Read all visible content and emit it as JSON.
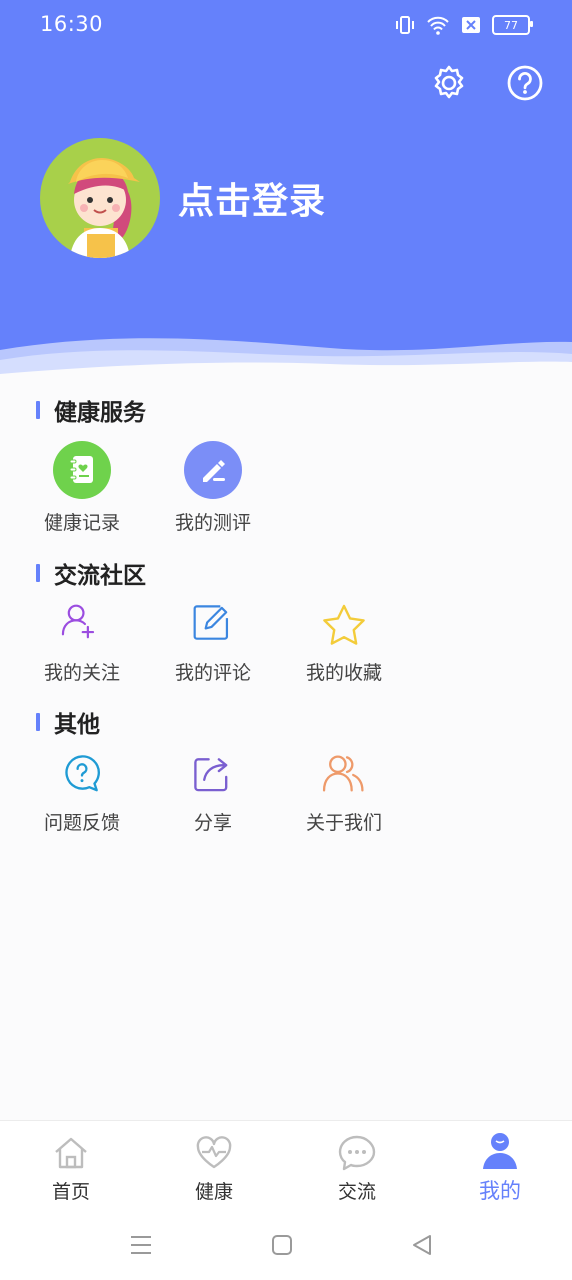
{
  "status": {
    "time": "16:30",
    "battery": "77"
  },
  "profile": {
    "login_label": "点击登录"
  },
  "sections": [
    {
      "title": "健康服务",
      "items": [
        {
          "label": "健康记录",
          "icon": "health-record-icon"
        },
        {
          "label": "我的测评",
          "icon": "assessment-icon"
        }
      ]
    },
    {
      "title": "交流社区",
      "items": [
        {
          "label": "我的关注",
          "icon": "follow-user-icon"
        },
        {
          "label": "我的评论",
          "icon": "edit-comment-icon"
        },
        {
          "label": "我的收藏",
          "icon": "star-icon"
        }
      ]
    },
    {
      "title": "其他",
      "items": [
        {
          "label": "问题反馈",
          "icon": "question-bubble-icon"
        },
        {
          "label": "分享",
          "icon": "share-icon"
        },
        {
          "label": "关于我们",
          "icon": "people-icon"
        }
      ]
    }
  ],
  "tabs": [
    {
      "label": "首页",
      "icon": "home-icon"
    },
    {
      "label": "健康",
      "icon": "heart-pulse-icon"
    },
    {
      "label": "交流",
      "icon": "chat-bubble-icon"
    },
    {
      "label": "我的",
      "icon": "user-icon",
      "active": true
    }
  ],
  "colors": {
    "primary": "#6581fb",
    "green": "#6fd24c",
    "purple": "#9b4de0",
    "blue": "#3b86e0",
    "yellow": "#f3cc3a",
    "teal": "#1f9bd4",
    "violet": "#7a5fd0",
    "orange": "#ee9a6a"
  }
}
